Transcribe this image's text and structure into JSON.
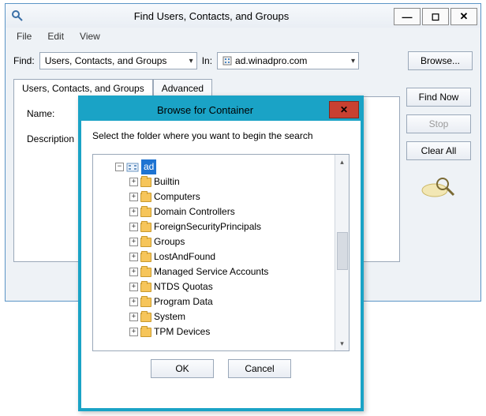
{
  "parent": {
    "title": "Find Users, Contacts, and Groups",
    "menu": {
      "file": "File",
      "edit": "Edit",
      "view": "View"
    },
    "find_label": "Find:",
    "find_value": "Users, Contacts, and Groups",
    "in_label": "In:",
    "in_value": "ad.winadpro.com",
    "browse": "Browse...",
    "tabs": {
      "ucg": "Users, Contacts, and Groups",
      "advanced": "Advanced"
    },
    "fields": {
      "name_label": "Name:",
      "description_label": "Description"
    },
    "buttons": {
      "find_now": "Find Now",
      "stop": "Stop",
      "clear_all": "Clear All"
    },
    "winbtns": {
      "min": "—",
      "max": "◻",
      "close": "✕"
    }
  },
  "dialog": {
    "title": "Browse for Container",
    "close_glyph": "✕",
    "instruction": "Select the folder where you want to begin the search",
    "root_label": "ad",
    "items": [
      "Builtin",
      "Computers",
      "Domain Controllers",
      "ForeignSecurityPrincipals",
      "Groups",
      "LostAndFound",
      "Managed Service Accounts",
      "NTDS Quotas",
      "Program Data",
      "System",
      "TPM Devices"
    ],
    "ok": "OK",
    "cancel": "Cancel"
  }
}
